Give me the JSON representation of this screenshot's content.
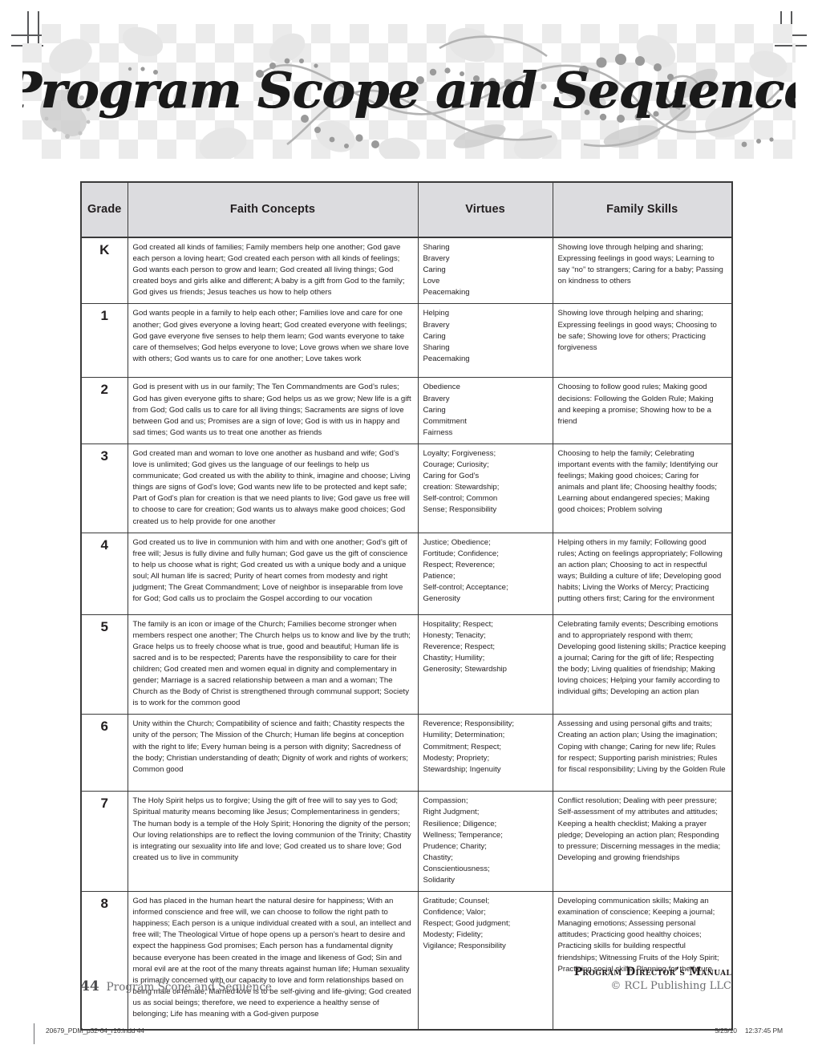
{
  "banner": {
    "title": "Program Scope and Sequence"
  },
  "table": {
    "headers": [
      "Grade",
      "Faith Concepts",
      "Virtues",
      "Family Skills"
    ],
    "rows": [
      {
        "grade": "K",
        "faith": "God created all kinds of families; Family members help one another; God gave each person a loving heart; God created each person with all kinds of feelings; God wants each person to grow and learn; God created all living things; God created boys and girls alike and different; A baby is a gift from God to the family; God gives us friends; Jesus teaches us how to help others",
        "virtues": "Sharing\nBravery\nCaring\nLove\nPeacemaking",
        "family": "Showing love through helping and sharing; Expressing feelings in good ways; Learning to say “no” to strangers; Caring for a baby; Passing on kindness to others"
      },
      {
        "grade": "1",
        "faith": "God wants people in a family to help each other; Families love and care for one another; God gives everyone a loving heart; God created everyone with feelings; God gave everyone five senses to help them learn; God wants everyone to take care of themselves; God helps everyone to love; Love grows when we share love with others; God wants us to care for one another; Love takes work",
        "virtues": "Helping\nBravery\nCaring\nSharing\nPeacemaking",
        "family": "Showing love through helping and sharing; Expressing feelings in good ways; Choosing to be safe; Showing love for others; Practicing forgiveness"
      },
      {
        "grade": "2",
        "faith": "God is present with us in our family; The Ten Commandments are God’s rules; God has given everyone gifts to share; God helps us as we grow; New life is a gift from God; God calls us to care for all living things; Sacraments are signs of love between God and us; Promises are a sign of love; God is with us in happy and sad times; God wants us to treat one another as friends",
        "virtues": "Obedience\nBravery\nCaring\nCommitment\nFairness",
        "family": "Choosing to follow good rules; Making good decisions: Following the Golden Rule; Making and keeping a promise; Showing how to be a friend"
      },
      {
        "grade": "3",
        "faith": "God created man and woman to love one another as husband and wife; God’s love is unlimited; God gives us the language of our feelings to help us communicate; God created us with the ability to think, imagine and choose; Living things are signs of God’s love; God wants new life to be protected and kept safe; Part of God’s plan for creation is that we need plants to live; God gave us free will to choose to care for creation; God wants us to always make good choices; God created us to help provide for one another",
        "virtues": "Loyalty; Forgiveness;\nCourage; Curiosity;\nCaring for God’s\ncreation: Stewardship;\nSelf-control; Common\nSense; Responsibility",
        "family": "Choosing to help the family; Celebrating important events with the family; Identifying our feelings; Making good choices; Caring for animals and plant life; Choosing healthy foods; Learning about endangered species; Making good choices; Problem solving"
      },
      {
        "grade": "4",
        "faith": "God created us to live in communion with him and with one another; God’s gift of free will; Jesus is fully divine and fully human; God gave us the gift of conscience to help us choose what is right; God created us with a unique body and a unique soul; All human life is sacred; Purity of heart comes from modesty and right judgment; The Great Commandment; Love of neighbor is inseparable from love for God; God calls us to proclaim the Gospel according to our vocation",
        "virtues": "Justice; Obedience;\nFortitude; Confidence;\nRespect; Reverence;\nPatience;\nSelf-control; Acceptance;\nGenerosity",
        "family": "Helping others in my family; Following good rules; Acting on feelings appropriately; Following an action plan; Choosing to act in respectful ways; Building a culture of life; Developing good habits; Living the Works of Mercy; Practicing putting others first; Caring for the environment"
      },
      {
        "grade": "5",
        "faith": "The family is an icon or image of the Church; Families become stronger when members respect one another; The Church helps us to know and live by the truth; Grace helps us to freely choose what is true, good and beautiful; Human life is sacred and is to be respected; Parents have the responsibility to care for their children; God created men and women equal in dignity and complementary in gender; Marriage is a sacred relationship between a man and a woman; The Church as the Body of Christ is strengthened through communal support; Society is to work for the common good",
        "virtues": "Hospitality; Respect;\nHonesty; Tenacity;\nReverence; Respect;\nChastity; Humility;\nGenerosity; Stewardship",
        "family": "Celebrating family events; Describing emotions and to appropriately respond with them; Developing good listening skills; Practice keeping a journal; Caring for the gift of life; Respecting the body; Living qualities of friendship; Making loving choices; Helping your family according to individual gifts; Developing an action plan"
      },
      {
        "grade": "6",
        "faith": "Unity within the Church; Compatibility of science and faith; Chastity respects the unity of the person; The Mission of the Church; Human life begins at conception with the right to life; Every human being is a person with dignity; Sacredness of the body; Christian understanding of death; Dignity of work and rights of workers; Common good",
        "virtues": "Reverence; Responsibility;\nHumility; Determination;\nCommitment; Respect;\nModesty; Propriety;\nStewardship; Ingenuity",
        "family": "Assessing and using personal gifts and traits; Creating an action plan; Using the imagination; Coping with change; Caring for new life; Rules for respect; Supporting parish ministries; Rules for fiscal responsibility; Living by the Golden Rule"
      },
      {
        "grade": "7",
        "faith": "The Holy Spirit helps us to forgive; Using the gift of free will to say yes to God; Spiritual maturity means becoming like Jesus; Complementariness in genders; The human body is a temple of the Holy Spirit; Honoring the dignity of the person; Our loving relationships are to reflect the loving communion of the Trinity; Chastity is integrating our sexuality into life and love; God created us to share love; God created us to live in community",
        "virtues": "Compassion;\nRight Judgment;\nResilience; Diligence;\nWellness; Temperance;\nPrudence; Charity;\nChastity;\nConscientiousness;\nSolidarity",
        "family": "Conflict resolution; Dealing with peer pressure; Self-assessment of my attributes and attitudes; Keeping a health checklist; Making a prayer pledge; Developing an action plan; Responding to pressure; Discerning messages in the media; Developing and growing friendships"
      },
      {
        "grade": "8",
        "faith": "God has placed in the human heart the natural desire for happiness; With an informed conscience and free will, we can choose to follow the right path to happiness; Each person is a unique individual created with a soul, an intellect and free will; The Theological Virtue of hope opens up a person’s heart to desire and expect the happiness God promises; Each person has a fundamental dignity because everyone has been created in the image and likeness of God; Sin and moral evil are at the root of the many threats against human life; Human sexuality is primarily concerned with our capacity to love and form relationships based on being male or female; Married love is to be self-giving and life-giving; God created us as social beings; therefore, we need to experience a healthy sense of belonging; Life has meaning with a God-given purpose",
        "virtues": "Gratitude; Counsel;\nConfidence; Valor;\nRespect; Good judgment;\nModesty; Fidelity;\nVigilance; Responsibility",
        "family": "Developing communication skills; Making an examination of conscience; Keeping a journal; Managing emotions; Assessing personal attitudes; Practicing good healthy choices; Practicing skills for building respectful friendships; Witnessing Fruits of the Holy Spirit; Practicing social skills; Planning for the future"
      }
    ]
  },
  "footer": {
    "page_number": "44",
    "section_label": "Program Scope and Sequence",
    "manual_title": "Program Director’s Manual",
    "copyright": "© RCL Publishing LLC"
  },
  "slug": {
    "filename": "20679_PDM_p32-64_r16.indd   44",
    "date": "5/25/10",
    "time": "12:37:45 PM"
  }
}
